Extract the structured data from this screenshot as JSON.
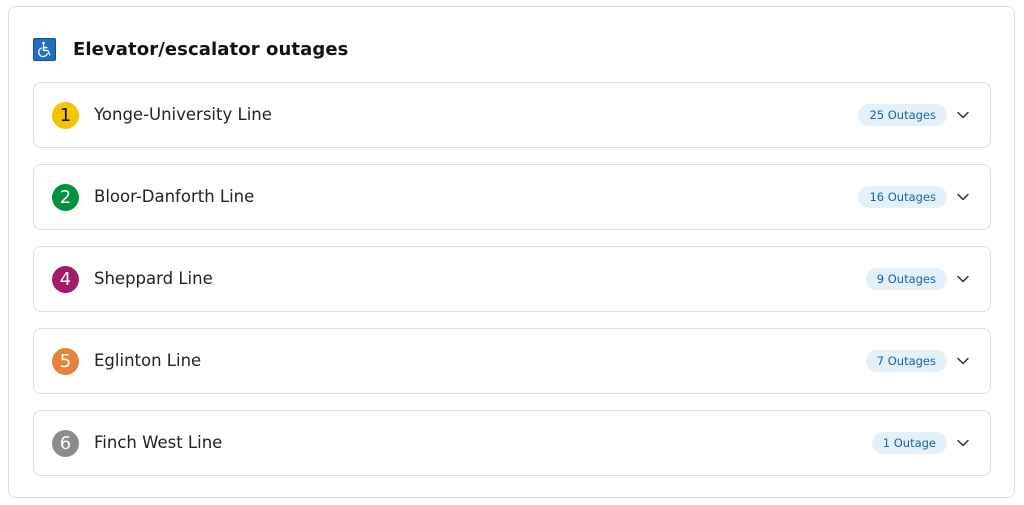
{
  "panel": {
    "title": "Elevator/escalator outages",
    "icon": "wheelchair-accessibility-icon"
  },
  "lines": [
    {
      "number": "1",
      "name": "Yonge-University Line",
      "outages": "25 Outages",
      "color": "#f5c400",
      "text_color": "#111111"
    },
    {
      "number": "2",
      "name": "Bloor-Danforth Line",
      "outages": "16 Outages",
      "color": "#00923f",
      "text_color": "#ffffff"
    },
    {
      "number": "4",
      "name": "Sheppard Line",
      "outages": "9 Outages",
      "color": "#a21a68",
      "text_color": "#ffffff"
    },
    {
      "number": "5",
      "name": "Eglinton Line",
      "outages": "7 Outages",
      "color": "#e8823a",
      "text_color": "#ffffff"
    },
    {
      "number": "6",
      "name": "Finch West Line",
      "outages": "1 Outage",
      "color": "#8c8c8c",
      "text_color": "#ffffff"
    }
  ],
  "colors": {
    "pill_bg": "#e4f1fb",
    "pill_text": "#17639f",
    "icon_bg": "#1f6fc5"
  }
}
